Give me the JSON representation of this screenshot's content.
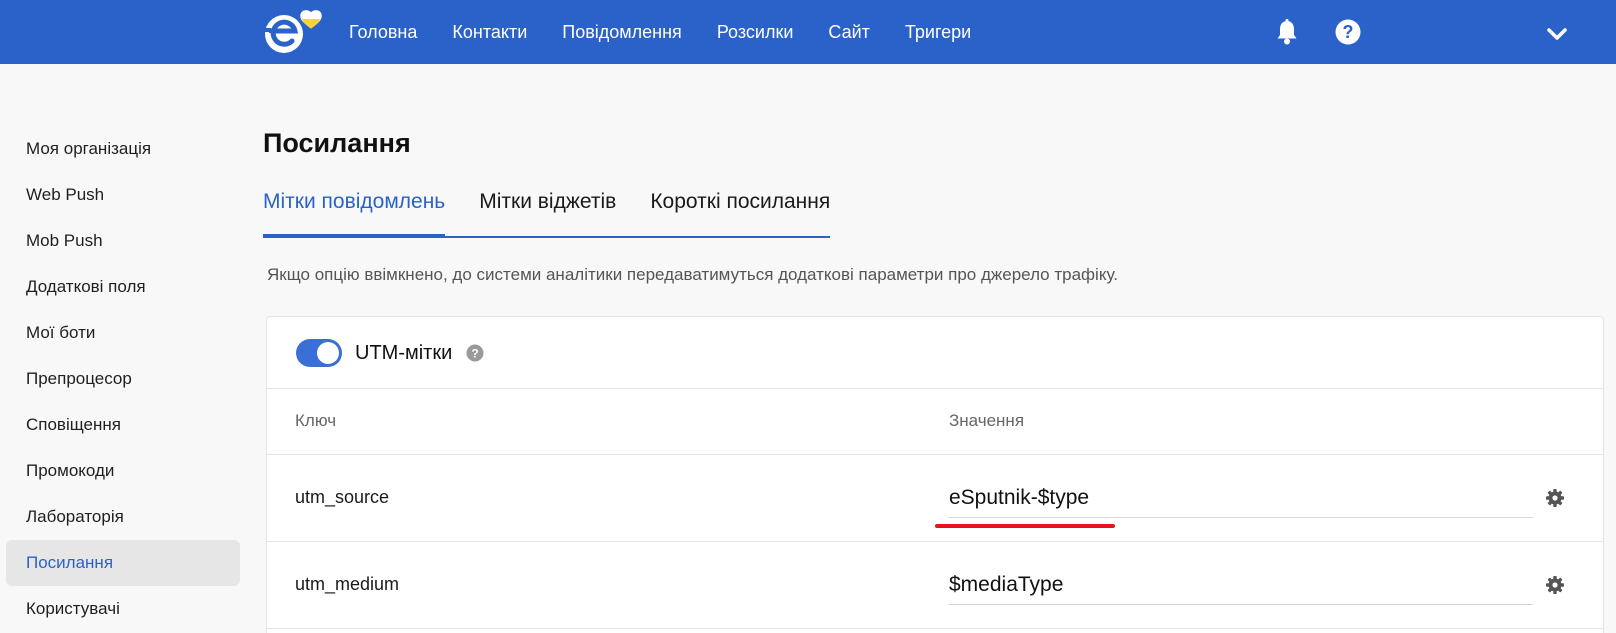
{
  "colors": {
    "brand": "#2b62c9",
    "accent_yellow": "#f6d33c",
    "highlight": "#e3151a"
  },
  "nav": {
    "items": [
      "Головна",
      "Контакти",
      "Повідомлення",
      "Розсилки",
      "Сайт",
      "Тригери"
    ],
    "icons": [
      "bell-icon",
      "help-icon",
      "chevron-down-icon"
    ]
  },
  "sidebar": {
    "items": [
      "Моя організація",
      "Web Push",
      "Mob Push",
      "Додаткові поля",
      "Мої боти",
      "Препроцесор",
      "Сповіщення",
      "Промокоди",
      "Лабораторія",
      "Посилання",
      "Користувачі"
    ],
    "active": "Посилання"
  },
  "page": {
    "title": "Посилання",
    "tabs": [
      "Мітки повідомлень",
      "Мітки віджетів",
      "Короткі посилання"
    ],
    "active_tab": "Мітки повідомлень",
    "info": "Якщо опцію ввімкнено, до системи аналітики передаватимуться додаткові параметри про джерело трафіку."
  },
  "utm": {
    "label": "UTM-мітки",
    "enabled": true,
    "columns": {
      "key": "Ключ",
      "value": "Значення"
    },
    "rows": [
      {
        "key": "utm_source",
        "value": "eSputnik-$type"
      },
      {
        "key": "utm_medium",
        "value": "$mediaType"
      }
    ]
  }
}
